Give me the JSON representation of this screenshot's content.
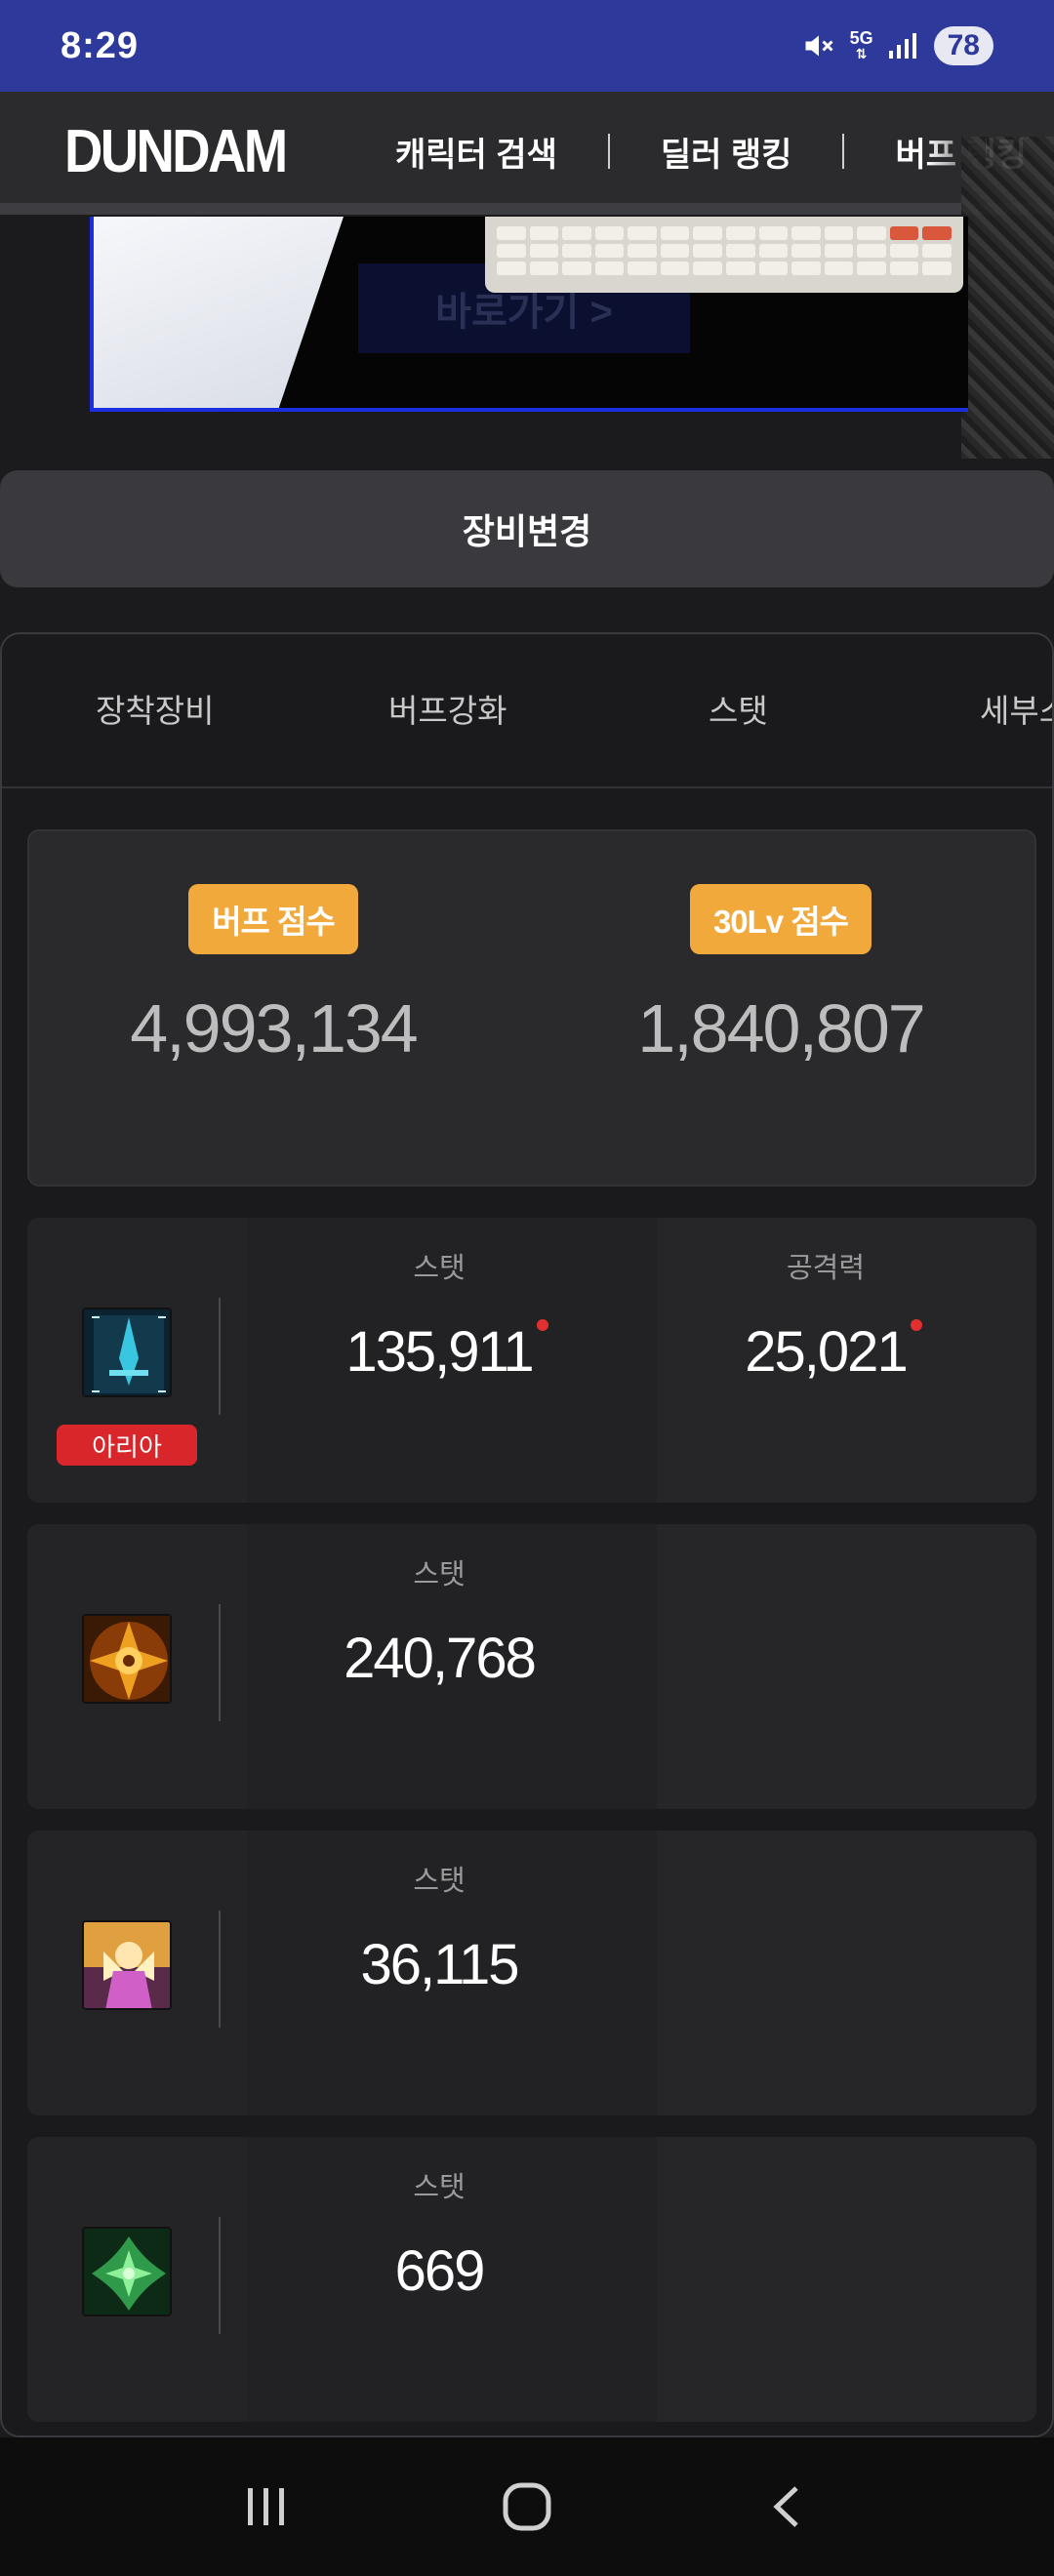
{
  "status_bar": {
    "time": "8:29",
    "network": "5G",
    "battery": "78"
  },
  "header": {
    "logo": "DUNDAM",
    "nav": [
      "캐릭터 검색",
      "딜러 랭킹",
      "버프 랭킹"
    ]
  },
  "banner": {
    "button_text": "바로가기 >"
  },
  "equip_change": "장비변경",
  "tabs": [
    "장착장비",
    "버프강화",
    "스탯",
    "세부스탯"
  ],
  "scores": [
    {
      "label": "버프 점수",
      "value": "4,993,134"
    },
    {
      "label": "30Lv 점수",
      "value": "1,840,807"
    }
  ],
  "rows": [
    {
      "icon": "sword-skill-icon",
      "badge": "아리아",
      "stats": [
        {
          "label": "스탯",
          "value": "135,911"
        },
        {
          "label": "공격력",
          "value": "25,021"
        }
      ]
    },
    {
      "icon": "golden-cross-skill-icon",
      "stats": [
        {
          "label": "스탯",
          "value": "240,768"
        }
      ]
    },
    {
      "icon": "angel-skill-icon",
      "stats": [
        {
          "label": "스탯",
          "value": "36,115"
        }
      ]
    },
    {
      "icon": "green-cross-skill-icon",
      "stats": [
        {
          "label": "스탯",
          "value": "669"
        }
      ]
    }
  ],
  "colors": {
    "status_bar": "#2d3a9c",
    "badge_orange": "#f2a93b",
    "badge_red": "#d8262b"
  }
}
